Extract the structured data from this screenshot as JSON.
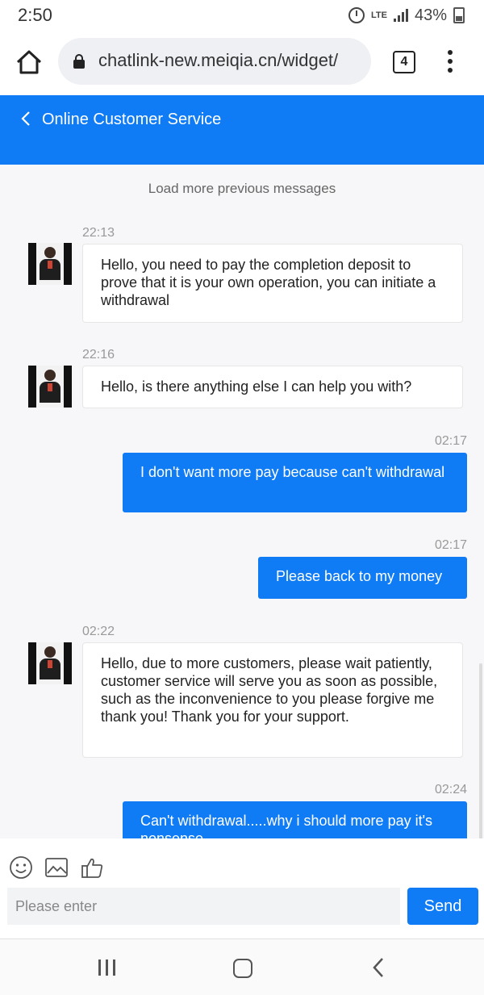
{
  "status_bar": {
    "time": "2:50",
    "network": "LTE",
    "battery": "43%"
  },
  "browser": {
    "url": "chatlink-new.meiqia.cn/widget/",
    "tab_count": "4"
  },
  "header": {
    "title": "Online Customer Service",
    "color": "#0f7bf5"
  },
  "chat": {
    "load_more": "Load more previous messages",
    "messages": [
      {
        "sender": "agent",
        "time": "22:13",
        "text": "Hello, you need to pay the completion deposit to prove that it is your own operation, you can initiate a withdrawal"
      },
      {
        "sender": "agent",
        "time": "22:16",
        "text": "Hello, is there anything else I can help you with?"
      },
      {
        "sender": "user",
        "time": "02:17",
        "text": "I don't want more pay because can't withdrawal"
      },
      {
        "sender": "user",
        "time": "02:17",
        "text": "Please back to my money"
      },
      {
        "sender": "agent",
        "time": "02:22",
        "text": "Hello, due to more customers, please wait patiently, customer service will serve you as soon as possible, such as the inconvenience to you please forgive me thank you! Thank you for your support."
      },
      {
        "sender": "user",
        "time": "02:24",
        "text": "Can't withdrawal.....why i should more pay it's nonsense"
      }
    ]
  },
  "composer": {
    "placeholder": "Please enter",
    "send_label": "Send",
    "icons": [
      "emoji-icon",
      "image-icon",
      "thumbs-up-icon"
    ]
  }
}
